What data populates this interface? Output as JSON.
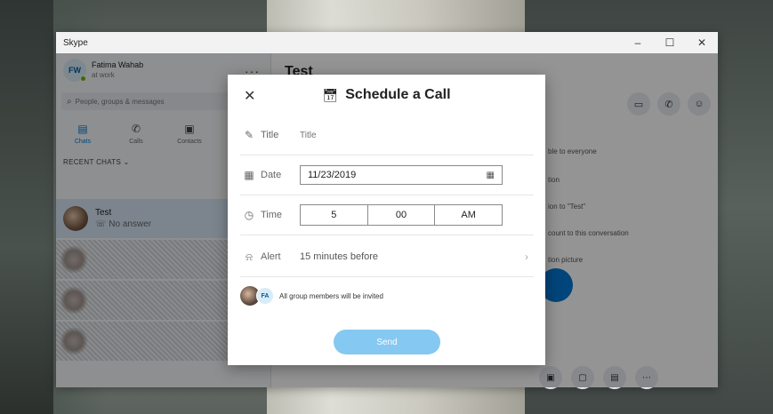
{
  "window": {
    "app_title": "Skype",
    "controls": {
      "minimize": "–",
      "maximize": "☐",
      "close": "✕"
    }
  },
  "sidebar": {
    "profile": {
      "initials": "FW",
      "name": "Fatima Wahab",
      "status": "at work"
    },
    "more": "···",
    "search": {
      "placeholder": "People, groups & messages"
    },
    "nav": [
      {
        "label": "Chats",
        "icon": "chat-icon"
      },
      {
        "label": "Calls",
        "icon": "phone-icon"
      },
      {
        "label": "Contacts",
        "icon": "contacts-icon"
      }
    ],
    "recent_header": "RECENT CHATS ⌄",
    "active_chat": {
      "name": "Test",
      "sub": "☏ No answer"
    }
  },
  "main": {
    "conversation_title": "Test",
    "info_lines": [
      "ble to everyone",
      "tion",
      "ion to \"Test\"",
      "count to this conversation",
      "tion picture"
    ]
  },
  "dialog": {
    "close": "✕",
    "title": "Schedule a Call",
    "title_row": {
      "label": "Title",
      "placeholder": "Title"
    },
    "date_row": {
      "label": "Date",
      "value": "11/23/2019"
    },
    "time_row": {
      "label": "Time",
      "hour": "5",
      "minute": "00",
      "period": "AM"
    },
    "alert_row": {
      "label": "Alert",
      "value": "15 minutes before"
    },
    "invite": {
      "avatar_initials": "FA",
      "text": "All group members will be invited"
    },
    "send_label": "Send"
  },
  "colors": {
    "accent": "#0078d4",
    "send_button": "#85c8f2",
    "active_chat_bg": "#d6e6f5"
  }
}
